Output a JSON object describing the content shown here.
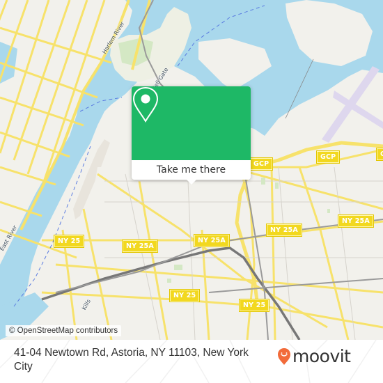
{
  "map": {
    "water_labels": {
      "harlem_river": "Harlem River",
      "hell_gate": "Hell Gate",
      "east_river": "East River",
      "kills": "Kills"
    },
    "shields": [
      {
        "id": "gcp-1",
        "label": "GCP"
      },
      {
        "id": "gcp-2",
        "label": "GCP"
      },
      {
        "id": "gcp-3",
        "label": "G"
      },
      {
        "id": "ny25a-1",
        "label": "NY 25A"
      },
      {
        "id": "ny25a-2",
        "label": "NY 25A"
      },
      {
        "id": "ny25a-3",
        "label": "NY 25A"
      },
      {
        "id": "ny25a-4",
        "label": "NY 25A"
      },
      {
        "id": "ny25-1",
        "label": "NY 25"
      },
      {
        "id": "ny25-2",
        "label": "NY 25"
      },
      {
        "id": "ny25-3",
        "label": "NY 25"
      }
    ],
    "attribution": "© OpenStreetMap contributors",
    "colors": {
      "land": "#f2f1ec",
      "water": "#a9d8ec",
      "park": "#d4e8c4",
      "road": "#f7e26b",
      "rail": "#777777",
      "runway": "#ded7ee"
    }
  },
  "popup": {
    "icon": "location-pin-icon",
    "button_label": "Take me there",
    "accent": "#1eb866"
  },
  "footer": {
    "address": "41-04 Newtown Rd, Astoria, NY 11103, New York City",
    "brand": "moovit",
    "brand_icon": "moovit-pin-icon",
    "brand_color": "#f26b3a"
  }
}
